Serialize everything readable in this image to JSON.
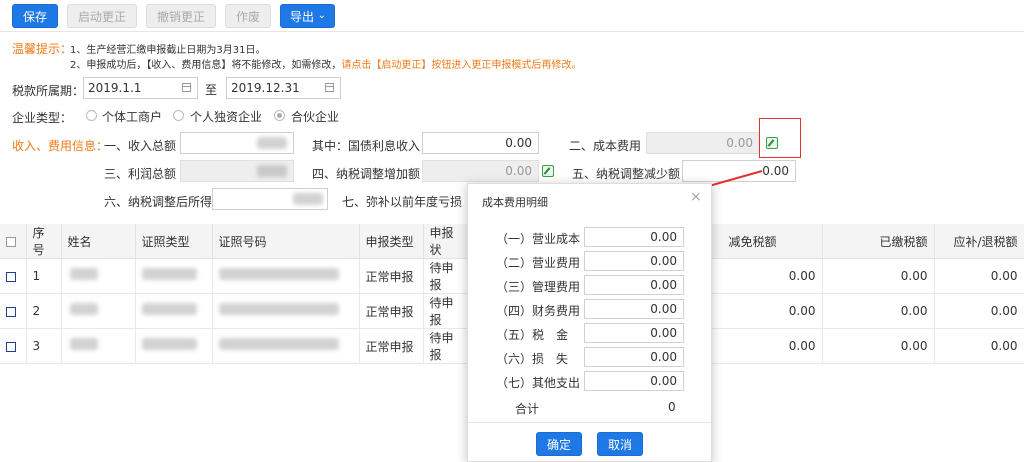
{
  "toolbar": {
    "save": "保存",
    "start_correction": "启动更正",
    "cancel_correction": "撤销更正",
    "void": "作废",
    "export": "导出"
  },
  "tips": {
    "label": "温馨提示：",
    "line1": "1、生产经营汇缴申报截止日期为3月31日。",
    "line2_prefix": "2、申报成功后，【收入、费用信息】将不能修改，如需修改，",
    "line2_highlight": "请点击【启动更正】按钮进入更正申报模式后再修改。"
  },
  "period": {
    "label": "税款所属期：",
    "start": "2019.1.1",
    "to": "至",
    "end": "2019.12.31"
  },
  "enterprise": {
    "label": "企业类型：",
    "options": [
      "个体工商户",
      "个人独资企业",
      "合伙企业"
    ],
    "selected": "合伙企业"
  },
  "income_info": {
    "label": "收入、费用信息：",
    "total_income_label": "一、收入总额",
    "treasury_interest_label": "其中：国债利息收入",
    "treasury_interest_value": "0.00",
    "cost_label": "二、成本费用",
    "cost_value": "0.00",
    "profit_label": "三、利润总额",
    "tax_increase_label": "四、纳税调整增加额",
    "tax_increase_value": "0.00",
    "tax_decrease_label": "五、纳税调整减少额",
    "tax_decrease_value": "0.00",
    "adjusted_income_label": "六、纳税调整后所得",
    "prior_loss_label": "七、弥补以前年度亏损"
  },
  "table": {
    "headers": [
      "序号",
      "姓名",
      "证照类型",
      "证照号码",
      "申报类型",
      "申报状",
      "减免税额",
      "已缴税额",
      "应补/退税额"
    ],
    "rows": [
      {
        "index": "1",
        "decl_type": "正常申报",
        "status": "待申报",
        "relief": "0.00",
        "paid": "0.00",
        "due": "0.00"
      },
      {
        "index": "2",
        "decl_type": "正常申报",
        "status": "待申报",
        "relief": "0.00",
        "paid": "0.00",
        "due": "0.00"
      },
      {
        "index": "3",
        "decl_type": "正常申报",
        "status": "待申报",
        "relief": "0.00",
        "paid": "0.00",
        "due": "0.00"
      }
    ]
  },
  "dialog": {
    "title": "成本费用明细",
    "items": [
      {
        "label": "（一）营业成本",
        "value": "0.00"
      },
      {
        "label": "（二）营业费用",
        "value": "0.00"
      },
      {
        "label": "（三）管理费用",
        "value": "0.00"
      },
      {
        "label": "（四）财务费用",
        "value": "0.00"
      },
      {
        "label": "（五）税　金",
        "value": "0.00"
      },
      {
        "label": "（六）损　失",
        "value": "0.00"
      },
      {
        "label": "（七）其他支出",
        "value": "0.00"
      }
    ],
    "total_label": "合计",
    "total_value": "0",
    "confirm": "确定",
    "cancel": "取消"
  },
  "colors": {
    "primary": "#1e78e6",
    "highlight_orange": "#f07a1a",
    "annotation_red": "#e53030"
  }
}
